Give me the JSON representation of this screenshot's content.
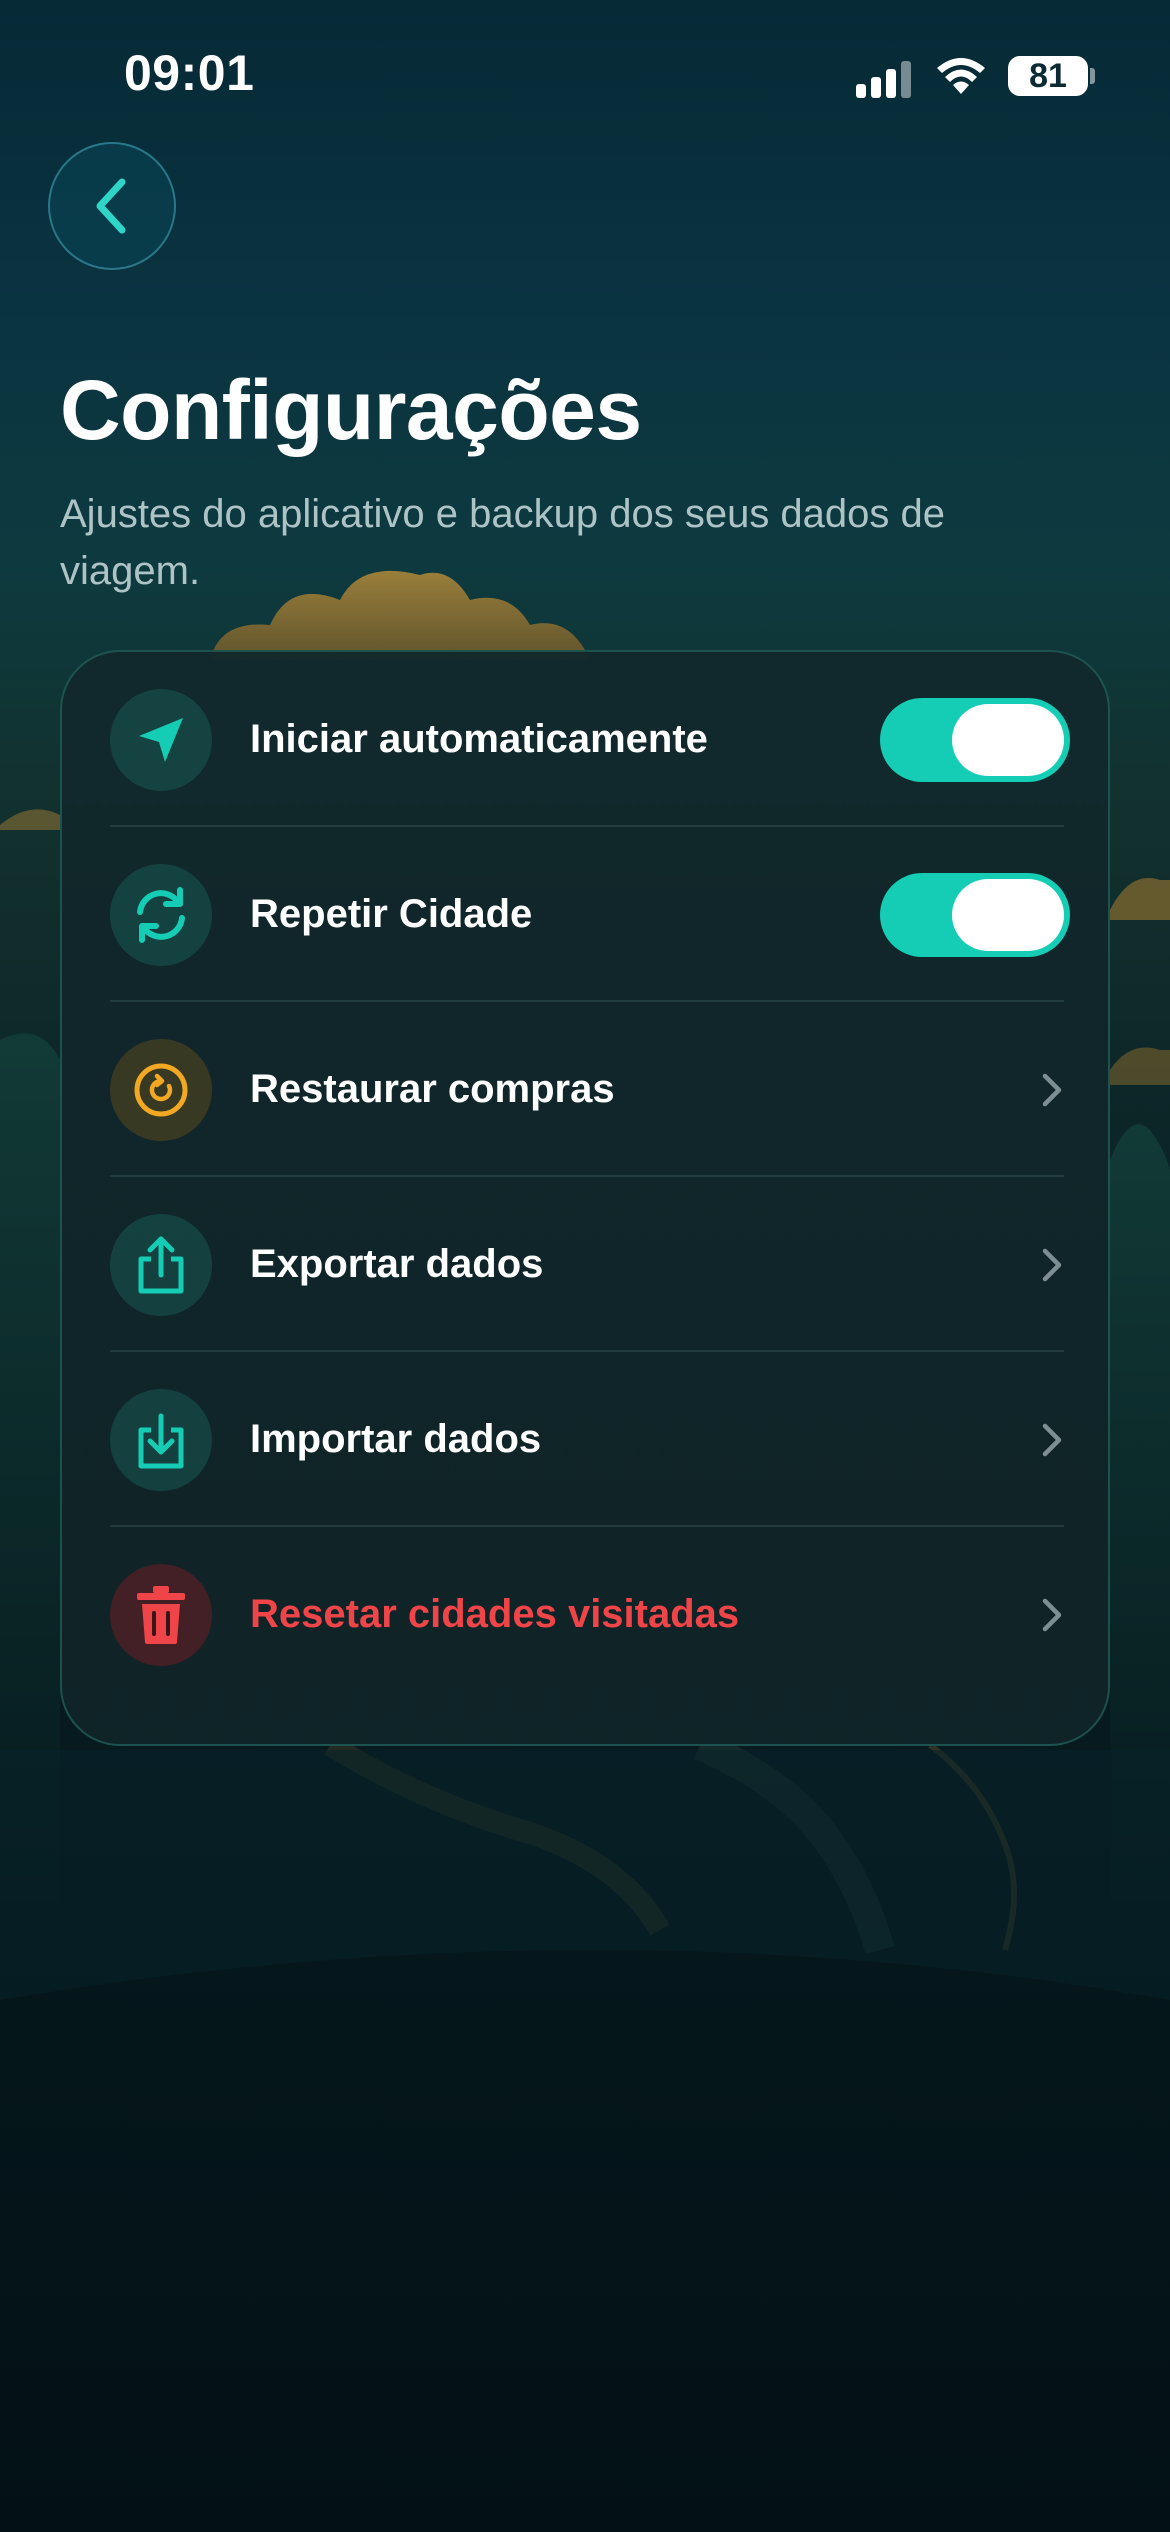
{
  "status_bar": {
    "time": "09:01",
    "battery": "81",
    "icons": [
      "cellular-signal-icon",
      "wifi-icon",
      "battery-icon"
    ]
  },
  "header": {
    "back_icon": "chevron-left-icon",
    "title": "Configurações",
    "subtitle": "Ajustes do aplicativo e backup dos seus dados de viagem."
  },
  "settings": {
    "items": [
      {
        "label": "Iniciar automaticamente",
        "icon": "location-arrow-icon",
        "control": "toggle",
        "on": true
      },
      {
        "label": "Repetir Cidade",
        "icon": "refresh-icon",
        "control": "toggle",
        "on": true
      },
      {
        "label": "Restaurar compras",
        "icon": "restore-icon",
        "control": "chevron"
      },
      {
        "label": "Exportar dados",
        "icon": "share-upload-icon",
        "control": "chevron"
      },
      {
        "label": "Importar dados",
        "icon": "download-icon",
        "control": "chevron"
      },
      {
        "label": "Resetar cidades visitadas",
        "icon": "trash-icon",
        "control": "chevron",
        "destructive": true
      }
    ]
  },
  "colors": {
    "accent": "#14cdb4",
    "warning": "#f2a823",
    "danger": "#ef4448",
    "background": "#062a36"
  }
}
